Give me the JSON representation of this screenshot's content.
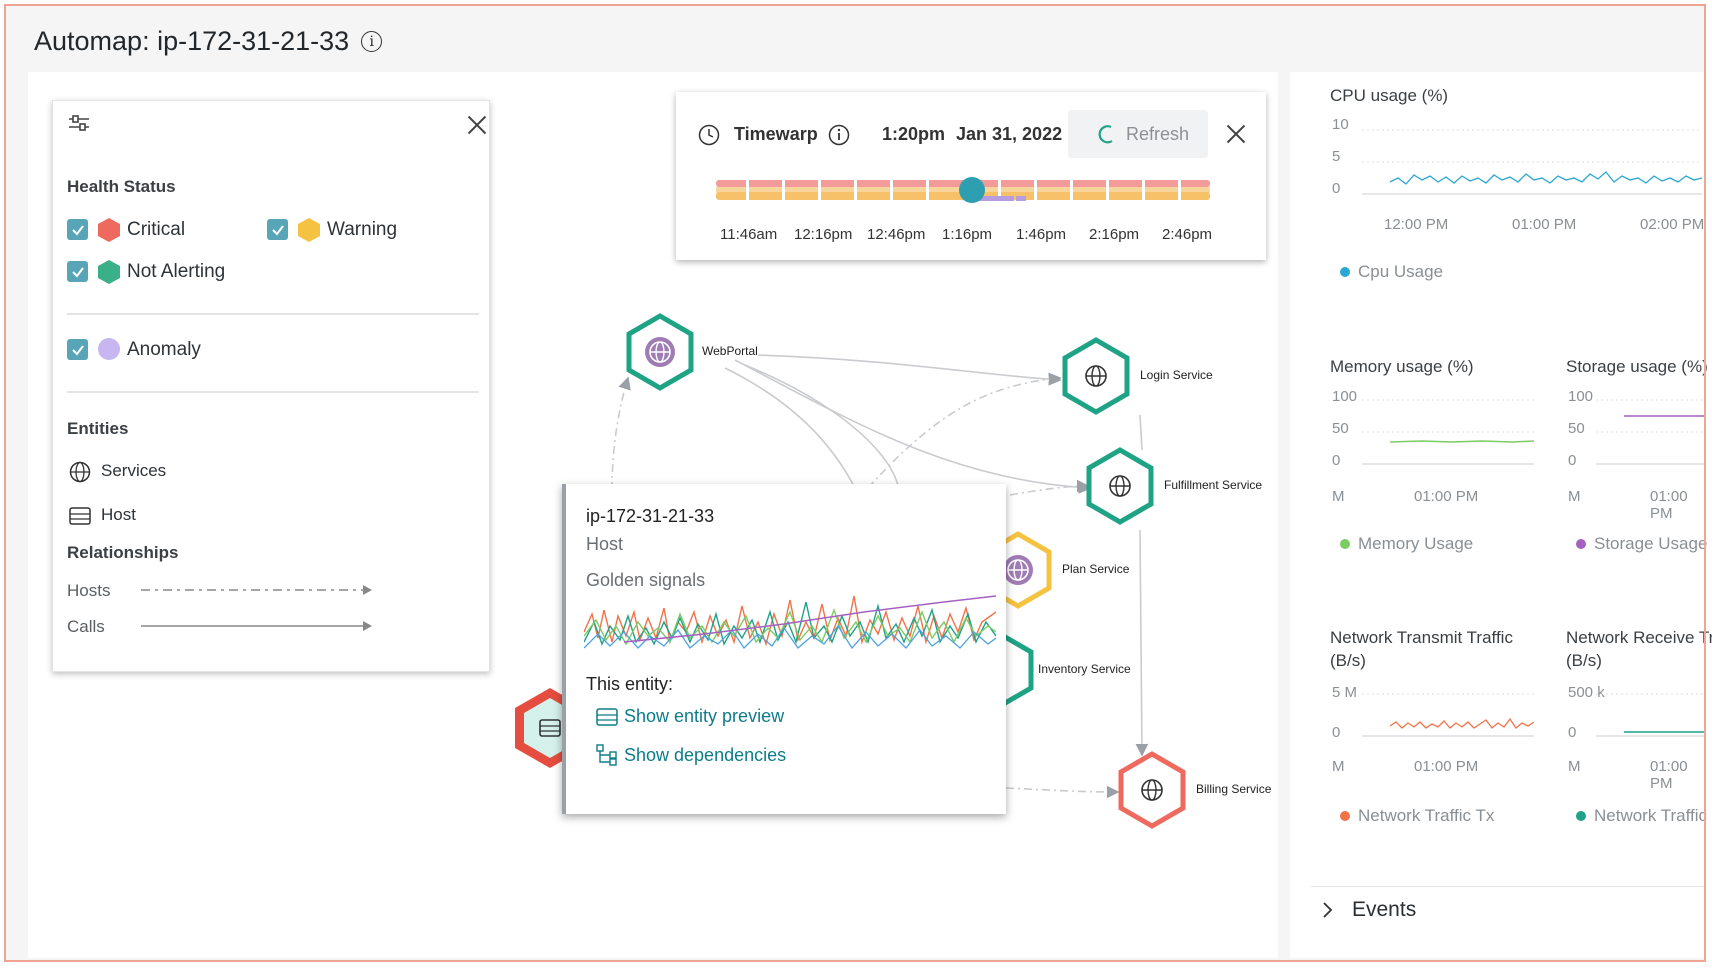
{
  "page": {
    "title": "Automap: ip-172-31-21-33",
    "info_icon": "i"
  },
  "filter": {
    "health_heading": "Health Status",
    "critical": "Critical",
    "warning": "Warning",
    "not_alerting": "Not Alerting",
    "anomaly": "Anomaly",
    "entities_heading": "Entities",
    "services": "Services",
    "host": "Host",
    "relationships_heading": "Relationships",
    "hosts_rel": "Hosts",
    "calls_rel": "Calls",
    "colors": {
      "critical": "#ef6a5e",
      "warning": "#f5c242",
      "not_alerting": "#3aaf88",
      "anomaly": "#c7b6ef",
      "checkbox": "#58a5b8"
    }
  },
  "timewarp": {
    "label": "Timewarp",
    "time": "1:20pm",
    "date": "Jan 31, 2022",
    "refresh": "Refresh",
    "ticks": [
      "11:46am",
      "12:16pm",
      "12:46pm",
      "1:16pm",
      "1:46pm",
      "2:16pm",
      "2:46pm"
    ]
  },
  "nodes": {
    "webportal": "WebPortal",
    "login": "Login Service",
    "fulfillment": "Fulfillment Service",
    "plan": "Plan Service",
    "inventory": "Inventory Service",
    "billing": "Billing Service"
  },
  "popover": {
    "host_name": "ip-172-31-21-33",
    "entity_type": "Host",
    "signals": "Golden signals",
    "this_entity": "This entity:",
    "preview": "Show entity preview",
    "dependencies": "Show dependencies"
  },
  "charts": {
    "cpu": {
      "title": "CPU usage (%)",
      "y": [
        "10",
        "5",
        "0"
      ],
      "x": [
        "12:00 PM",
        "01:00 PM",
        "02:00 PM"
      ],
      "legend": "Cpu Usage",
      "color": "#29a8d4"
    },
    "memory": {
      "title": "Memory usage (%)",
      "y": [
        "100",
        "50",
        "0"
      ],
      "x0": "M",
      "x": "01:00 PM",
      "legend": "Memory Usage",
      "color": "#7ccc64"
    },
    "storage": {
      "title": "Storage usage (%)",
      "y": [
        "100",
        "50",
        "0"
      ],
      "x0": "M",
      "x": "01:00 PM",
      "legend": "Storage Usage",
      "color": "#a561c2"
    },
    "tx": {
      "title1": "Network Transmit Traffic",
      "title2": "(B/s)",
      "y": [
        "5 M",
        "0"
      ],
      "x0": "M",
      "x": "01:00 PM",
      "legend": "Network Traffic Tx",
      "color": "#f07348"
    },
    "rx": {
      "title1": "Network Receive Traffic",
      "title2": "(B/s)",
      "y": [
        "500 k",
        "0"
      ],
      "x0": "M",
      "x": "01:00 PM",
      "legend": "Network Traffic Rx",
      "color": "#1fa18a"
    }
  },
  "events": "Events"
}
